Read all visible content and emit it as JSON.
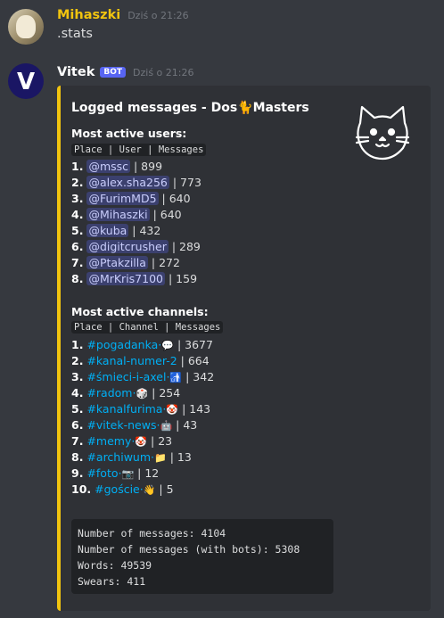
{
  "messages": [
    {
      "author": "Mihaszki",
      "time": "Dziś o 21:26",
      "text": ".stats"
    },
    {
      "author": "Vitek",
      "badge": "BOT",
      "time": "Dziś o 21:26",
      "avatar_letter": "V"
    }
  ],
  "embed": {
    "title": "Logged messages - Dos🐈Masters",
    "users_heading": "Most active users:",
    "users_header": "Place | User | Messages",
    "users": [
      {
        "place": "1.",
        "name": "@mssc",
        "count": "| 899"
      },
      {
        "place": "2.",
        "name": "@alex.sha256",
        "count": "| 773"
      },
      {
        "place": "3.",
        "name": "@FurimMD5",
        "count": "| 640"
      },
      {
        "place": "4.",
        "name": "@Mihaszki",
        "count": "| 640"
      },
      {
        "place": "5.",
        "name": "@kuba",
        "count": "| 432"
      },
      {
        "place": "6.",
        "name": "@digitcrusher",
        "count": "| 289"
      },
      {
        "place": "7.",
        "name": "@Ptakzilla",
        "count": "| 272"
      },
      {
        "place": "8.",
        "name": "@MrKris7100",
        "count": "| 159"
      }
    ],
    "channels_heading": "Most active channels:",
    "channels_header": "Place | Channel | Messages",
    "channels": [
      {
        "place": "1.",
        "name": "#pogadanka·",
        "emoji": "💬",
        "count": "| 3677"
      },
      {
        "place": "2.",
        "name": "#kanal-numer-2",
        "emoji": "",
        "count": "| 664"
      },
      {
        "place": "3.",
        "name": "#śmieci-i-axel·",
        "emoji": "🚮",
        "count": "| 342"
      },
      {
        "place": "4.",
        "name": "#radom·",
        "emoji": "🎲",
        "count": "| 254"
      },
      {
        "place": "5.",
        "name": "#kanalfurima·",
        "emoji": "🤡",
        "count": "| 143"
      },
      {
        "place": "6.",
        "name": "#vitek-news·",
        "emoji": "🤖",
        "count": "| 43"
      },
      {
        "place": "7.",
        "name": "#memy·",
        "emoji": "🤡",
        "count": "| 23"
      },
      {
        "place": "8.",
        "name": "#archiwum·",
        "emoji": "📁",
        "count": "| 13"
      },
      {
        "place": "9.",
        "name": "#foto·",
        "emoji": "📷",
        "count": "| 12"
      },
      {
        "place": "10.",
        "name": "#goście·",
        "emoji": "👋",
        "count": "| 5"
      }
    ],
    "stats": [
      "Number of messages: 4104",
      "Number of messages (with bots): 5308",
      "Words: 49539",
      "Swears: 411"
    ]
  },
  "colors": {
    "accent": "#f1c40f",
    "link": "#00aff4",
    "mention": "#c9cdfb",
    "bot_badge": "#5865f2"
  },
  "icons": {
    "thumbnail": "cat-face-icon"
  }
}
